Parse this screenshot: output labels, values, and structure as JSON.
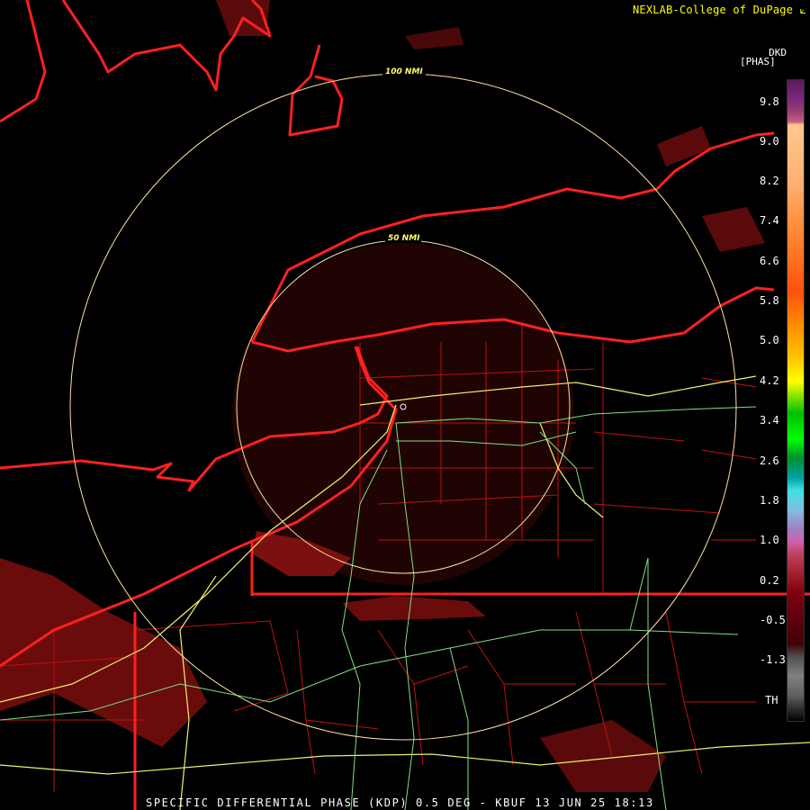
{
  "credit": "NEXLAB-College of DuPage",
  "product_code": "DKD",
  "units": "[PHAS]",
  "colorbar": {
    "labels": [
      "9.8",
      "9.0",
      "8.2",
      "7.4",
      "6.6",
      "5.8",
      "5.0",
      "4.2",
      "3.4",
      "2.6",
      "1.8",
      "1.0",
      "0.2",
      "-0.5",
      "-1.3",
      "TH"
    ]
  },
  "range_rings": [
    "100 NMI",
    "50 NMI"
  ],
  "footer": "SPECIFIC DIFFERENTIAL PHASE (KDP) 0.5 DEG - KBUF 13 JUN 25 18:13",
  "colors": {
    "borders": "#ff2020",
    "counties": "#cc1010",
    "rings": "#ffe0a0",
    "highways": "#f0f070",
    "roads": "#80e080"
  }
}
